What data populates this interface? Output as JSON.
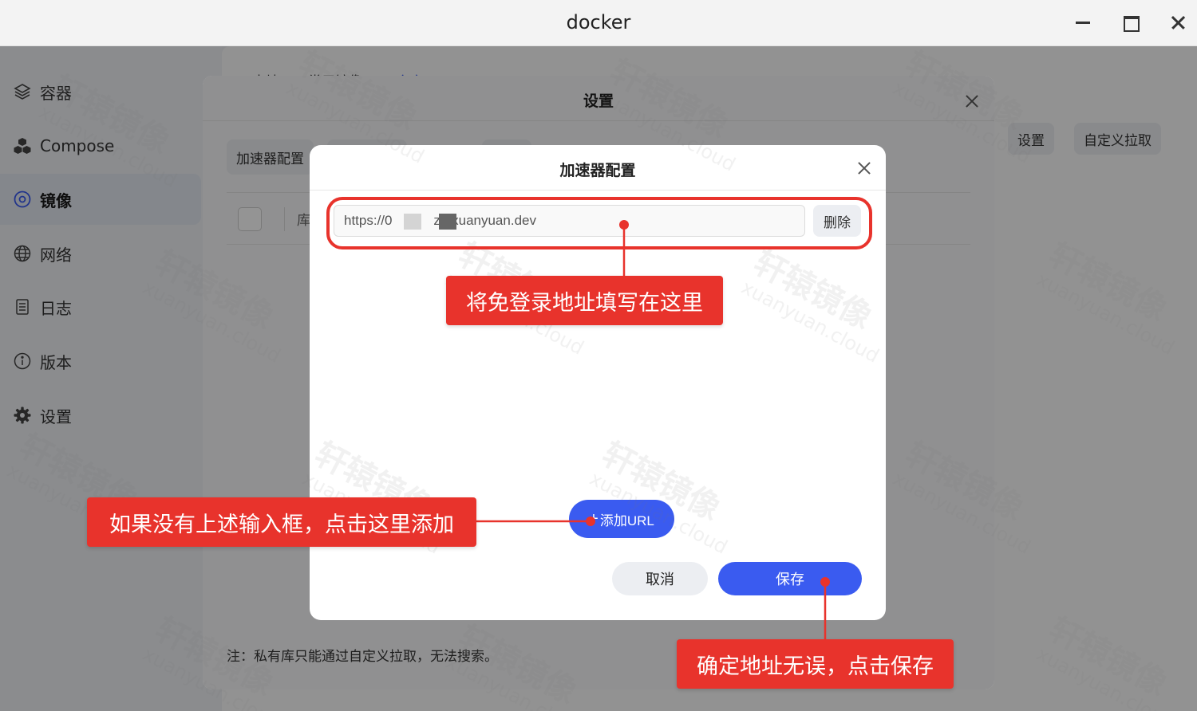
{
  "window": {
    "title": "docker"
  },
  "sidebar": {
    "items": [
      {
        "label": "容器",
        "icon": "layers-icon"
      },
      {
        "label": "Compose",
        "icon": "cubes-icon"
      },
      {
        "label": "镜像",
        "icon": "disc-icon",
        "active": true
      },
      {
        "label": "网络",
        "icon": "globe-icon"
      },
      {
        "label": "日志",
        "icon": "document-icon"
      },
      {
        "label": "版本",
        "icon": "info-icon"
      },
      {
        "label": "设置",
        "icon": "gear-icon"
      }
    ]
  },
  "main": {
    "tabs": [
      "本地",
      "常用镜像",
      "仓库"
    ],
    "settings_button": "设置",
    "custom_pull_button": "自定义拉取"
  },
  "settings_dialog": {
    "title": "设置",
    "tab": "加速器配置",
    "table_column": "库",
    "note": "注：私有库只能通过自定义拉取，无法搜索。"
  },
  "accelerator_dialog": {
    "title": "加速器配置",
    "url_value": "https://0           z3.xuanyuan.dev",
    "delete_button": "删除",
    "add_url_button": "添加URL",
    "cancel_button": "取消",
    "save_button": "保存"
  },
  "annotations": {
    "fill_address": "将免登录地址填写在这里",
    "add_hint": "如果没有上述输入框，点击这里添加",
    "confirm_save": "确定地址无误，点击保存",
    "color": "#e8332c"
  },
  "watermark": {
    "text": "轩辕镜像",
    "sub": "xuanyuan.cloud"
  },
  "colors": {
    "primary": "#3a5bf0",
    "callout": "#e8332c",
    "sidebar_bg": "#eff1f5"
  }
}
